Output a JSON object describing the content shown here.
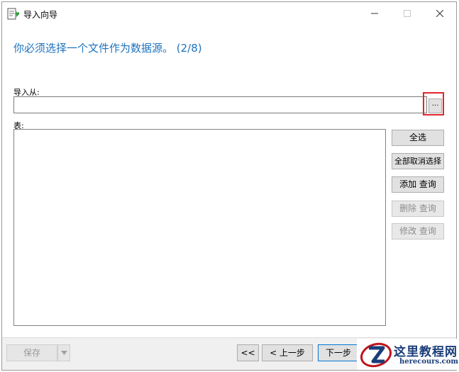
{
  "window": {
    "title": "导入向导",
    "icon": "import-wizard-icon"
  },
  "heading": "你必须选择一个文件作为数据源。 (2/8)",
  "import_from": {
    "label": "导入从:",
    "value": "",
    "browse_label": "..."
  },
  "tables": {
    "label": "表:"
  },
  "side_buttons": {
    "select_all": "全选",
    "deselect_all": "全部取消选择",
    "add_query": "添加 查询",
    "delete_query": "删除 查询",
    "modify_query": "修改 查询"
  },
  "footer": {
    "save_label": "保存",
    "first_label": "<<",
    "prev_label": "< 上一步",
    "next_label": "下一步"
  },
  "watermark": {
    "text": "这里教程网",
    "url": "herecours.com"
  },
  "colors": {
    "heading": "#1e73be",
    "highlight": "#e0262d",
    "watermark": "#1b3d7a"
  }
}
